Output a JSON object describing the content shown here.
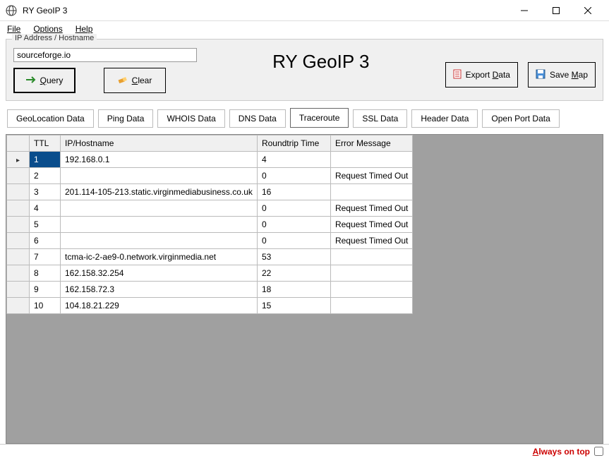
{
  "window": {
    "title": "RY GeoIP 3"
  },
  "menu": {
    "file": "File",
    "options": "Options",
    "help": "Help"
  },
  "groupbox": {
    "legend": "IP Address / Hostname"
  },
  "input": {
    "hostname": "sourceforge.io"
  },
  "buttons": {
    "query": "Query",
    "clear": "Clear",
    "export": "Export Data",
    "save_map": "Save Map"
  },
  "app_title": "RY GeoIP 3",
  "tabs": {
    "geo": "GeoLocation Data",
    "ping": "Ping Data",
    "whois": "WHOIS Data",
    "dns": "DNS Data",
    "trace": "Traceroute",
    "ssl": "SSL Data",
    "header": "Header Data",
    "port": "Open Port Data"
  },
  "table": {
    "headers": {
      "ttl": "TTL",
      "ip": "IP/Hostname",
      "rt": "Roundtrip Time",
      "err": "Error Message"
    },
    "rows": [
      {
        "ttl": "1",
        "ip": "192.168.0.1",
        "rt": "4",
        "err": ""
      },
      {
        "ttl": "2",
        "ip": "",
        "rt": "0",
        "err": "Request Timed Out"
      },
      {
        "ttl": "3",
        "ip": "201.114-105-213.static.virginmediabusiness.co.uk",
        "rt": "16",
        "err": ""
      },
      {
        "ttl": "4",
        "ip": "",
        "rt": "0",
        "err": "Request Timed Out"
      },
      {
        "ttl": "5",
        "ip": "",
        "rt": "0",
        "err": "Request Timed Out"
      },
      {
        "ttl": "6",
        "ip": "",
        "rt": "0",
        "err": "Request Timed Out"
      },
      {
        "ttl": "7",
        "ip": "tcma-ic-2-ae9-0.network.virginmedia.net",
        "rt": "53",
        "err": ""
      },
      {
        "ttl": "8",
        "ip": "162.158.32.254",
        "rt": "22",
        "err": ""
      },
      {
        "ttl": "9",
        "ip": "162.158.72.3",
        "rt": "18",
        "err": ""
      },
      {
        "ttl": "10",
        "ip": "104.18.21.229",
        "rt": "15",
        "err": ""
      }
    ]
  },
  "status": {
    "always_on_top": "Always on top"
  }
}
